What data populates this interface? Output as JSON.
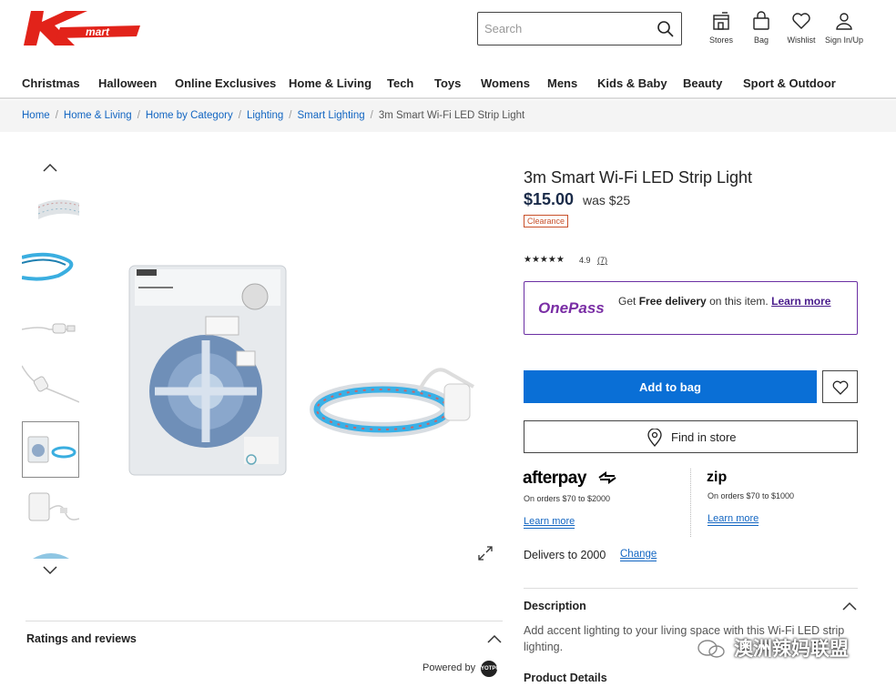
{
  "header": {
    "search_placeholder": "Search",
    "icons": [
      {
        "name": "store-icon",
        "label": "Stores"
      },
      {
        "name": "bag-icon",
        "label": "Bag"
      },
      {
        "name": "heart-icon",
        "label": "Wishlist"
      },
      {
        "name": "user-icon",
        "label": "Sign In/Up"
      }
    ]
  },
  "nav": [
    "Christmas",
    "Halloween",
    "Online Exclusives",
    "Home & Living",
    "Tech",
    "Toys",
    "Womens",
    "Mens",
    "Kids & Baby",
    "Beauty",
    "Sport & Outdoor"
  ],
  "breadcrumb": [
    "Home",
    "Home & Living",
    "Home by Category",
    "Lighting",
    "Smart Lighting"
  ],
  "breadcrumb_current": "3m Smart Wi-Fi LED Strip Light",
  "product": {
    "title": "3m Smart Wi-Fi LED Strip Light",
    "price": "$15.00",
    "was": "was $25",
    "tag": "Clearance",
    "stars": "★★★★★",
    "rating": "4.9",
    "review_count": "(7)"
  },
  "onepass": {
    "logo": "OnePass",
    "text_pre": "Get ",
    "text_bold": "Free delivery",
    "text_post": " on this item. ",
    "learn": "Learn more"
  },
  "actions": {
    "add_to_bag": "Add to bag",
    "find_in_store": "Find in store"
  },
  "afterpay": {
    "logo": "afterpay",
    "sub": "On orders $70 to $2000",
    "learn": "Learn more"
  },
  "zip": {
    "logo": "zip",
    "sub": "On orders $70 to $1000",
    "learn": "Learn more"
  },
  "delivery": {
    "text": "Delivers to 2000",
    "change": "Change"
  },
  "description": {
    "heading": "Description",
    "body": "Add accent lighting to your living space with this Wi-Fi LED strip lighting."
  },
  "product_details_heading": "Product Details",
  "ratings_heading": "Ratings and reviews",
  "powered_by": "Powered by",
  "powered_logo": "YOTPO",
  "watermark": "澳洲辣妈联盟",
  "colors": {
    "brand_red": "#e2231a",
    "primary_blue": "#0a6fd6",
    "link_blue": "#1366c2",
    "onepass_purple": "#6b2fa3",
    "clearance_orange": "#c8502a"
  }
}
